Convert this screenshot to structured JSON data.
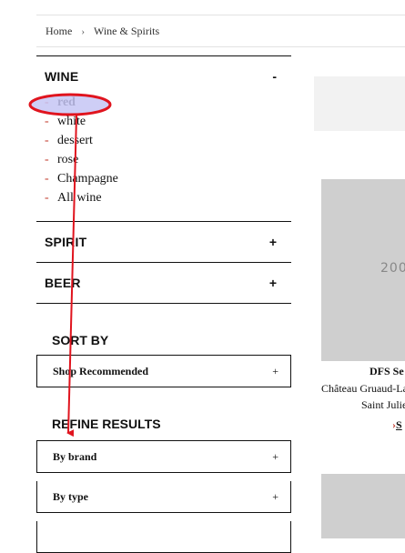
{
  "breadcrumb": {
    "home": "Home",
    "separator": "›",
    "current": "Wine & Spirits"
  },
  "sections": {
    "wine": {
      "title": "WINE",
      "toggle": "-",
      "items": [
        {
          "dash": "-",
          "label": "red"
        },
        {
          "dash": "-",
          "label": "white"
        },
        {
          "dash": "-",
          "label": "dessert"
        },
        {
          "dash": "-",
          "label": "rose"
        },
        {
          "dash": "-",
          "label": "Champagne"
        },
        {
          "dash": "-",
          "label": "All wine"
        }
      ]
    },
    "spirit": {
      "title": "SPIRIT",
      "toggle": "+"
    },
    "beer": {
      "title": "BEER",
      "toggle": "+"
    }
  },
  "sort": {
    "heading": "SORT BY",
    "option": "Shop Recommended",
    "toggle": "+"
  },
  "refine": {
    "heading": "REFINE RESULTS",
    "options": [
      {
        "label": "By brand",
        "toggle": "+"
      },
      {
        "label": "By type",
        "toggle": "+"
      }
    ]
  },
  "product": {
    "image_text": "200",
    "store": "DFS Se",
    "name": "Château Gruaud-La",
    "region": "Saint Julie",
    "link_chevron": "›",
    "link_text": "S"
  },
  "annotation": {
    "highlight_color": "#e0141e",
    "highlight_fill": "#c5c5f5",
    "arrow_color": "#e0141e"
  }
}
